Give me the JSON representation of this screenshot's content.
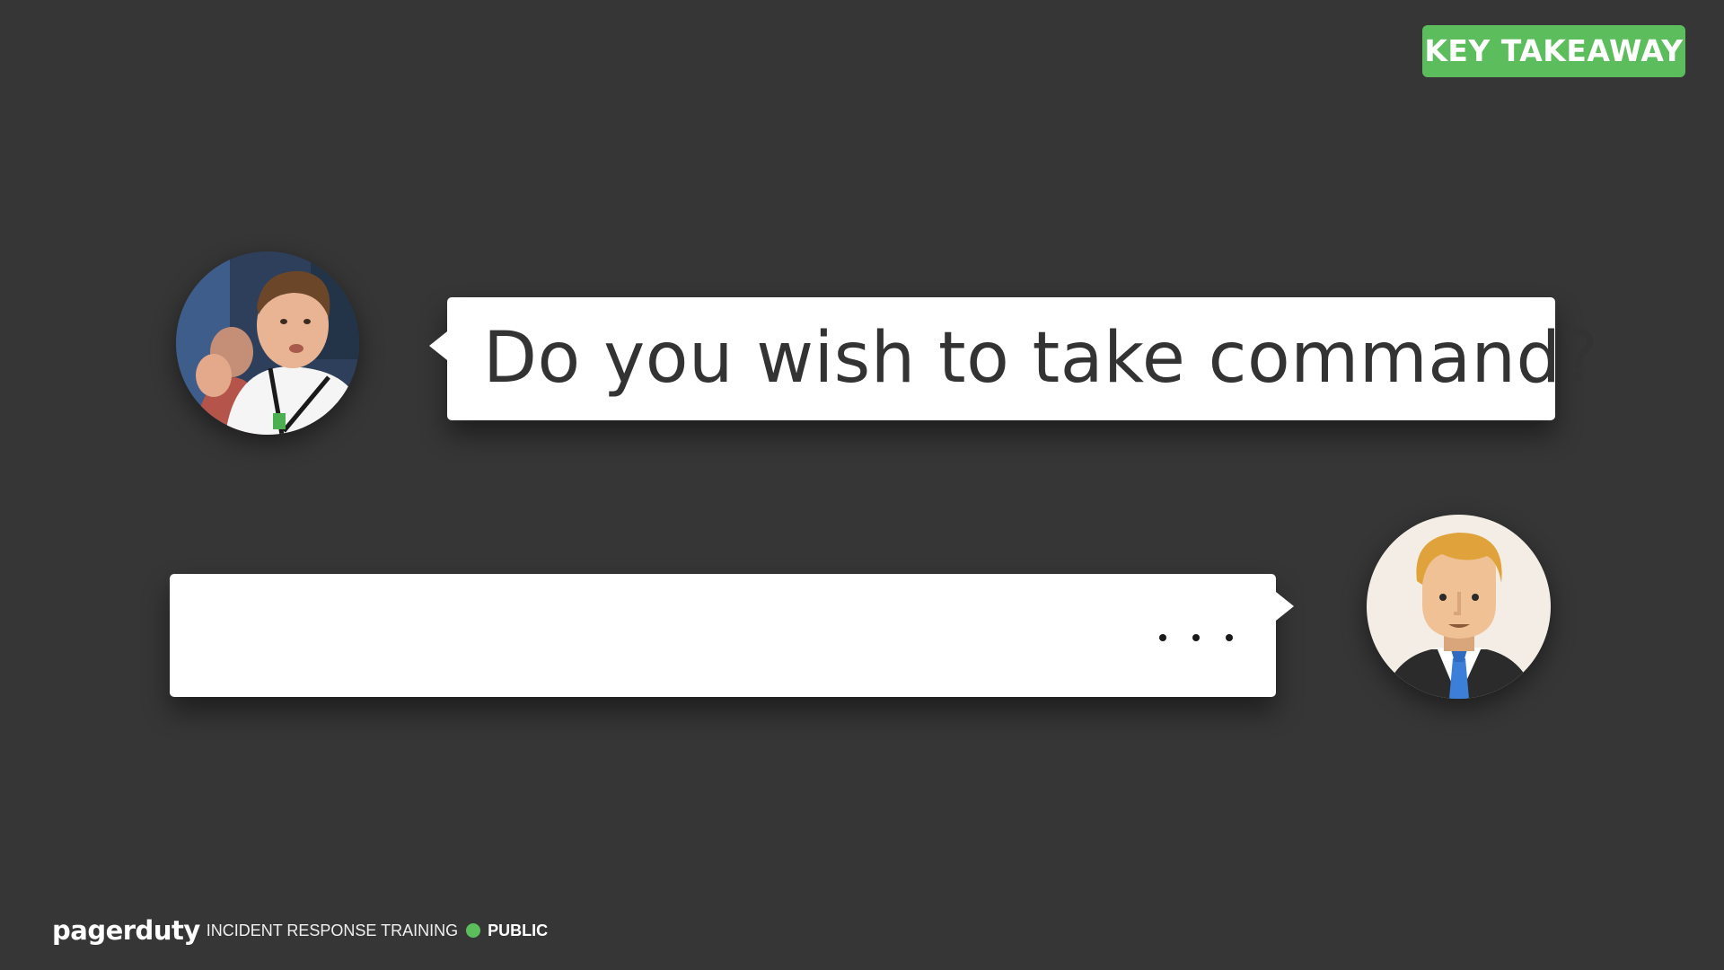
{
  "badge": {
    "label": "KEY TAKEAWAY",
    "color": "#5cbd5c"
  },
  "conversation": {
    "question": {
      "text": "Do you wish to take command?",
      "speaker_avatar": "photo-avatar"
    },
    "reply": {
      "state": "typing",
      "typing_indicator": "typing-dots-icon",
      "speaker_avatar": "businessman-avatar-icon"
    }
  },
  "footer": {
    "logo": "pagerduty",
    "subtitle": "INCIDENT RESPONSE TRAINING",
    "status_dot_color": "#5cbd5c",
    "classification": "PUBLIC"
  },
  "colors": {
    "background": "#363636",
    "bubble": "#ffffff",
    "accent": "#5cbd5c",
    "text": "#333333"
  }
}
